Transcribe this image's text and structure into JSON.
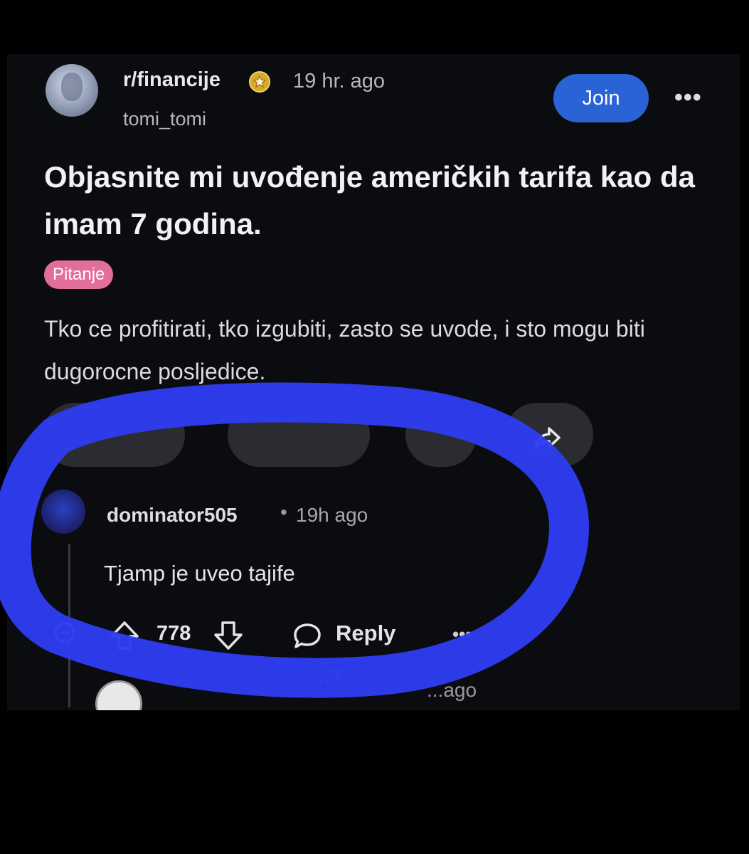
{
  "post": {
    "subreddit": "r/financije",
    "badge_icon": "award-badge-icon",
    "time": "19 hr. ago",
    "author": "tomi_tomi",
    "join_label": "Join",
    "more_label": "•••",
    "title": "Objasnite mi uvođenje američkih tarifa kao da imam 7 godina.",
    "flair": "Pitanje",
    "body": "Tko ce profitirati, tko izgubiti, zasto se uvode, i sto mogu biti dugorocne posljedice."
  },
  "comment": {
    "user": "dominator505",
    "separator": "•",
    "time": "19h ago",
    "text": "Tjamp je uveo tajife",
    "score": "778",
    "reply_label": "Reply",
    "more_label": "•••"
  },
  "next_comment": {
    "name_fragment": "..?",
    "time_fragment": "...ago"
  },
  "colors": {
    "background": "#0b0c10",
    "join_button": "#2a63d6",
    "flair": "#e26e9b",
    "marker": "#2f3cf0"
  }
}
